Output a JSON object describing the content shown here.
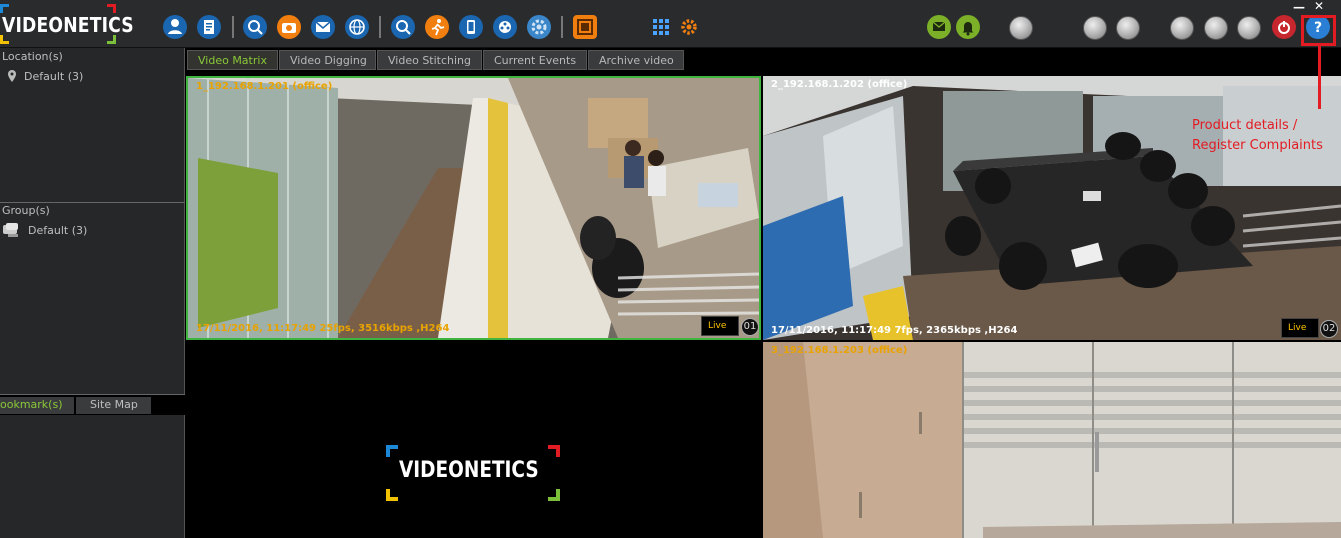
{
  "app": {
    "brand": "VIDEONETICS",
    "brand_colors": {
      "blue": "#1e88d8",
      "red": "#e31b23",
      "green": "#7bbf3a",
      "yellow": "#f2c200"
    }
  },
  "toolbar": {
    "icons": [
      "user-icon",
      "report-icon",
      "search-camera-icon",
      "snapshot-icon",
      "mail-icon",
      "globe-icon",
      "magnify-icon",
      "running-man-icon",
      "mobile-icon",
      "film-reel-icon",
      "gear-wheel-icon",
      "monitor-icon",
      "grid-layout-icon",
      "settings-gear-icon",
      "message-icon",
      "alarm-bell-icon",
      "help-icon"
    ],
    "window_controls": {
      "minimize": "—",
      "close": "✕"
    }
  },
  "left_panel": {
    "locations": {
      "title": "Location(s)",
      "items": [
        "Default (3)"
      ]
    },
    "groups": {
      "title": "Group(s)",
      "items": [
        "Default (3)"
      ]
    },
    "bottom_tabs": [
      {
        "label": "ookmark(s)",
        "active": true
      },
      {
        "label": "Site Map",
        "active": false
      }
    ]
  },
  "main_tabs": [
    {
      "label": "Video Matrix",
      "active": true
    },
    {
      "label": "Video Digging",
      "active": false
    },
    {
      "label": "Video Stitching",
      "active": false
    },
    {
      "label": "Current Events",
      "active": false
    },
    {
      "label": "Archive video",
      "active": false
    }
  ],
  "cameras": [
    {
      "label": "1_192.168.1.201 (office)",
      "info": "17/11/2016, 11:17:49  25fps, 3516kbps ,H264",
      "status": "Live",
      "number": "01",
      "label_color": "#e8a300",
      "info_color": "#e8a300"
    },
    {
      "label": "2_192.168.1.202 (office)",
      "info": "17/11/2016, 11:17:49  7fps, 2365kbps ,H264",
      "status": "Live",
      "number": "02",
      "label_color": "#ffffff",
      "info_color": "#ffffff"
    },
    {
      "label": "3_192.168.1.203 (office)",
      "label_color": "#e8a300"
    }
  ],
  "empty_cell": {
    "brand": "VIDEONETICS"
  },
  "annotation": {
    "line1": "Product details /",
    "line2": "Register Complaints",
    "color": "#e31b23"
  }
}
